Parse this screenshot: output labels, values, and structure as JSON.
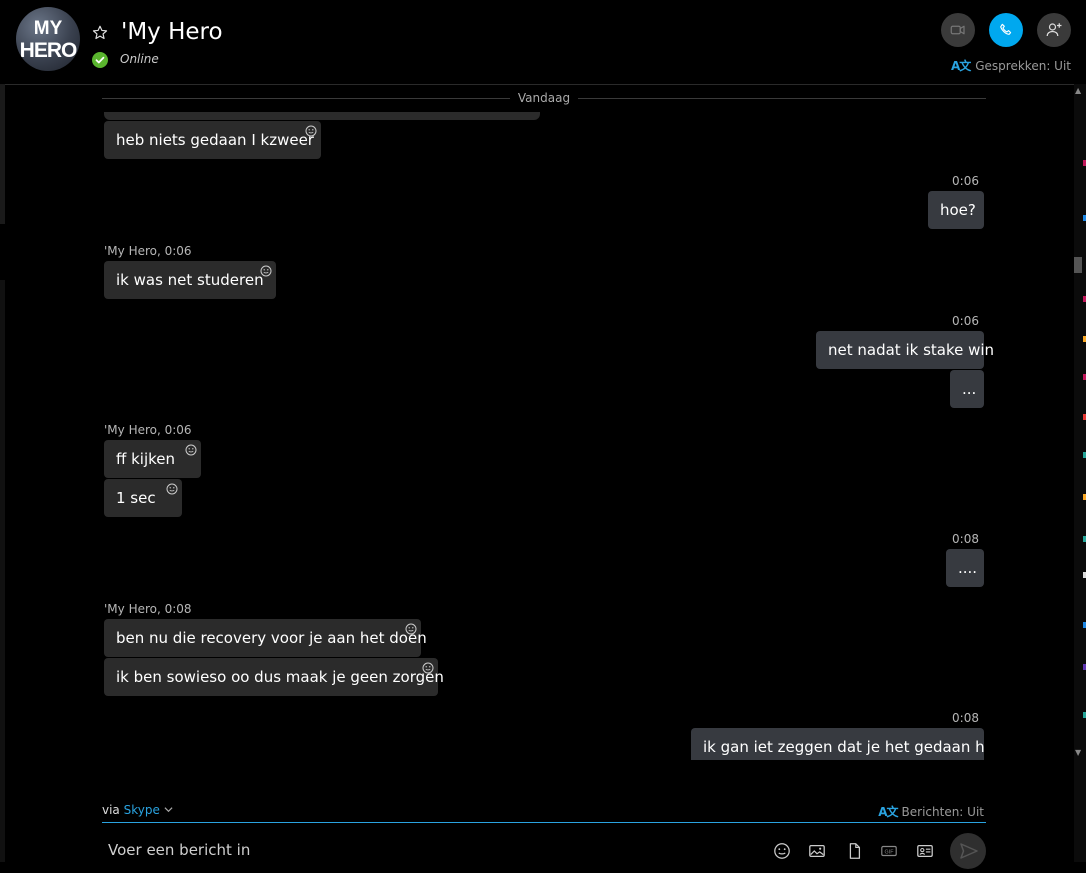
{
  "header": {
    "avatar_text": "MY HERO",
    "title": "'My Hero",
    "status": "Online",
    "translate_label": "Gesprekken: Uit"
  },
  "separator": {
    "label": "Vandaag"
  },
  "messages": [
    {
      "side": "them",
      "text": "heb niets gedaan I kzweer"
    },
    {
      "side": "me",
      "time": "0:06",
      "text": "hoe?"
    },
    {
      "side": "them",
      "meta": "'My Hero, 0:06",
      "text": "ik was net studeren"
    },
    {
      "side": "me",
      "time": "0:06",
      "text": "net nadat ik stake win"
    },
    {
      "side": "me",
      "text": "..."
    },
    {
      "side": "them",
      "meta": "'My Hero, 0:06",
      "text": "ff kijken"
    },
    {
      "side": "them",
      "text": "1 sec"
    },
    {
      "side": "me",
      "time": "0:08",
      "text": "...."
    },
    {
      "side": "them",
      "meta": "'My Hero, 0:08",
      "text": "ben nu die recovery voor je aan het doen"
    },
    {
      "side": "them",
      "text": "ik ben sowieso oo dus maak je geen zorgen"
    },
    {
      "side": "me",
      "time": "0:08",
      "text": "ik gan iet zeggen dat je het gedaan hebt"
    }
  ],
  "composer": {
    "via_label": "via",
    "via_service": "Skype",
    "translate_label": "Berichten: Uit",
    "placeholder": "Voer een bericht in"
  },
  "colors": {
    "accent": "#00a8ef",
    "online": "#5ab52e",
    "bubble_them": "#2b2b2b",
    "bubble_me": "#373a40"
  },
  "icons": [
    "star-icon",
    "video-icon",
    "phone-icon",
    "add-person-icon",
    "translate-icon",
    "emoji-icon",
    "image-icon",
    "file-icon",
    "gif-icon",
    "contact-card-icon",
    "send-icon"
  ]
}
